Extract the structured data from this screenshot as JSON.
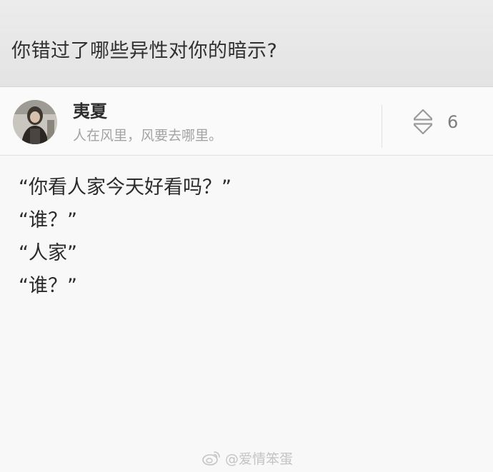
{
  "question": {
    "title": "你错过了哪些异性对你的暗示?"
  },
  "author": {
    "name": "夷夏",
    "bio": "人在风里，风要去哪里。",
    "avatar_icon": "user-avatar-photo"
  },
  "vote": {
    "icon": "vote-up-down-icon",
    "count": "6"
  },
  "answer": {
    "lines": [
      "“你看人家今天好看吗？”",
      "“谁？”",
      "“人家”",
      "“谁？”"
    ]
  },
  "watermark": {
    "icon": "weibo-icon",
    "text": "@爱情笨蛋"
  }
}
